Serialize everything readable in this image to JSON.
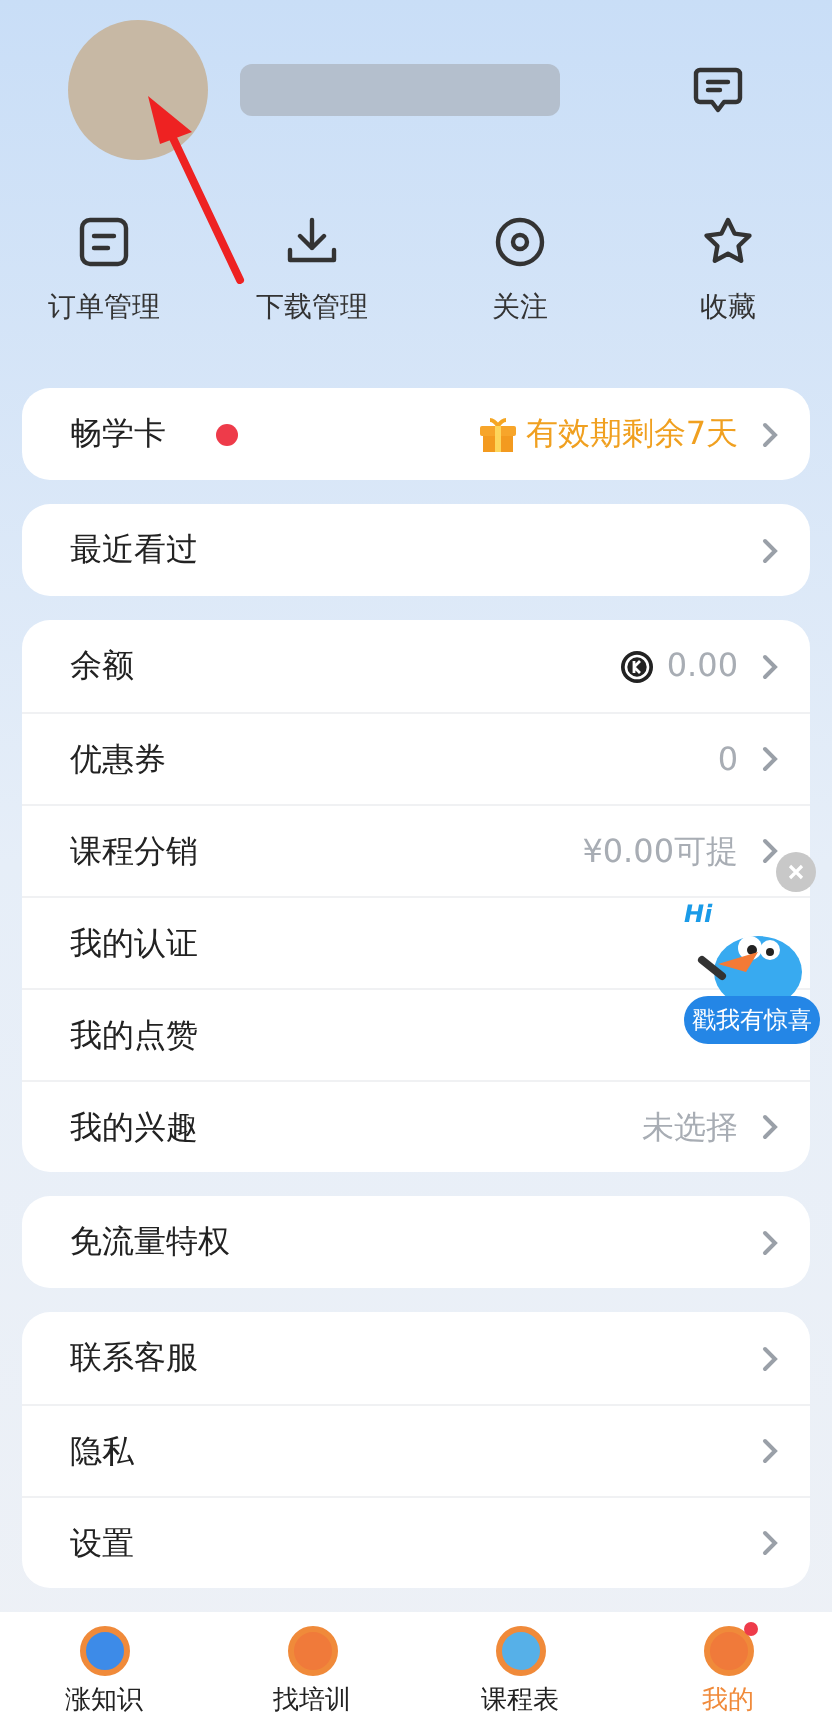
{
  "quick_actions": [
    {
      "label": "订单管理"
    },
    {
      "label": "下载管理"
    },
    {
      "label": "关注"
    },
    {
      "label": "收藏"
    }
  ],
  "groups": [
    {
      "rows": [
        {
          "label": "畅学卡",
          "dot": true,
          "gift": true,
          "value": "有效期剩余7天"
        }
      ]
    },
    {
      "rows": [
        {
          "label": "最近看过"
        }
      ]
    },
    {
      "rows": [
        {
          "label": "余额",
          "coin": true,
          "value": "0.00",
          "chevron": true
        },
        {
          "label": "优惠券",
          "value": "0",
          "chevron": true
        },
        {
          "label": "课程分销",
          "value": "¥0.00可提",
          "chevron": true
        },
        {
          "label": "我的认证",
          "chevron": false
        },
        {
          "label": "我的点赞",
          "chevron": false
        },
        {
          "label": "我的兴趣",
          "value": "未选择",
          "chevron": true
        }
      ]
    },
    {
      "rows": [
        {
          "label": "免流量特权"
        }
      ]
    },
    {
      "rows": [
        {
          "label": "联系客服"
        },
        {
          "label": "隐私"
        },
        {
          "label": "设置"
        }
      ]
    }
  ],
  "floating_promo": {
    "greeting": "Hi",
    "label": "戳我有惊喜"
  },
  "tab_bar": [
    {
      "label": "涨知识",
      "selected": false
    },
    {
      "label": "找培训",
      "selected": false
    },
    {
      "label": "课程表",
      "selected": false
    },
    {
      "label": "我的",
      "selected": true,
      "badge": true
    }
  ]
}
